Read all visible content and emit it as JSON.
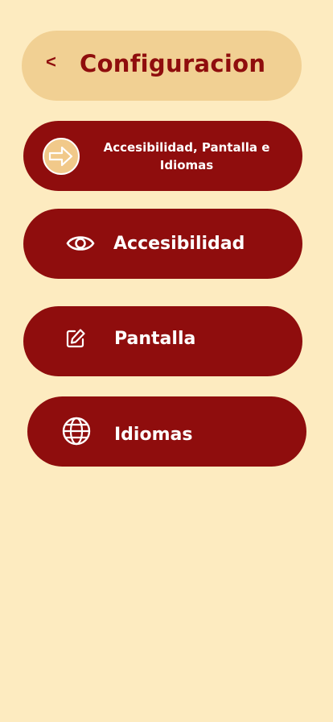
{
  "header": {
    "back_label": "<",
    "title": "Configuracion"
  },
  "menu": {
    "items": [
      {
        "label": "Accesibilidad, Pantalla e Idiomas",
        "icon": "arrow-right-circle-icon"
      },
      {
        "label": "Accesibilidad",
        "icon": "eye-icon"
      },
      {
        "label": "Pantalla",
        "icon": "edit-icon"
      },
      {
        "label": "Idiomas",
        "icon": "globe-icon"
      }
    ]
  },
  "colors": {
    "background": "#fdebc0",
    "header": "#f1d093",
    "button": "#8f0d0d",
    "text": "#ffffff"
  }
}
